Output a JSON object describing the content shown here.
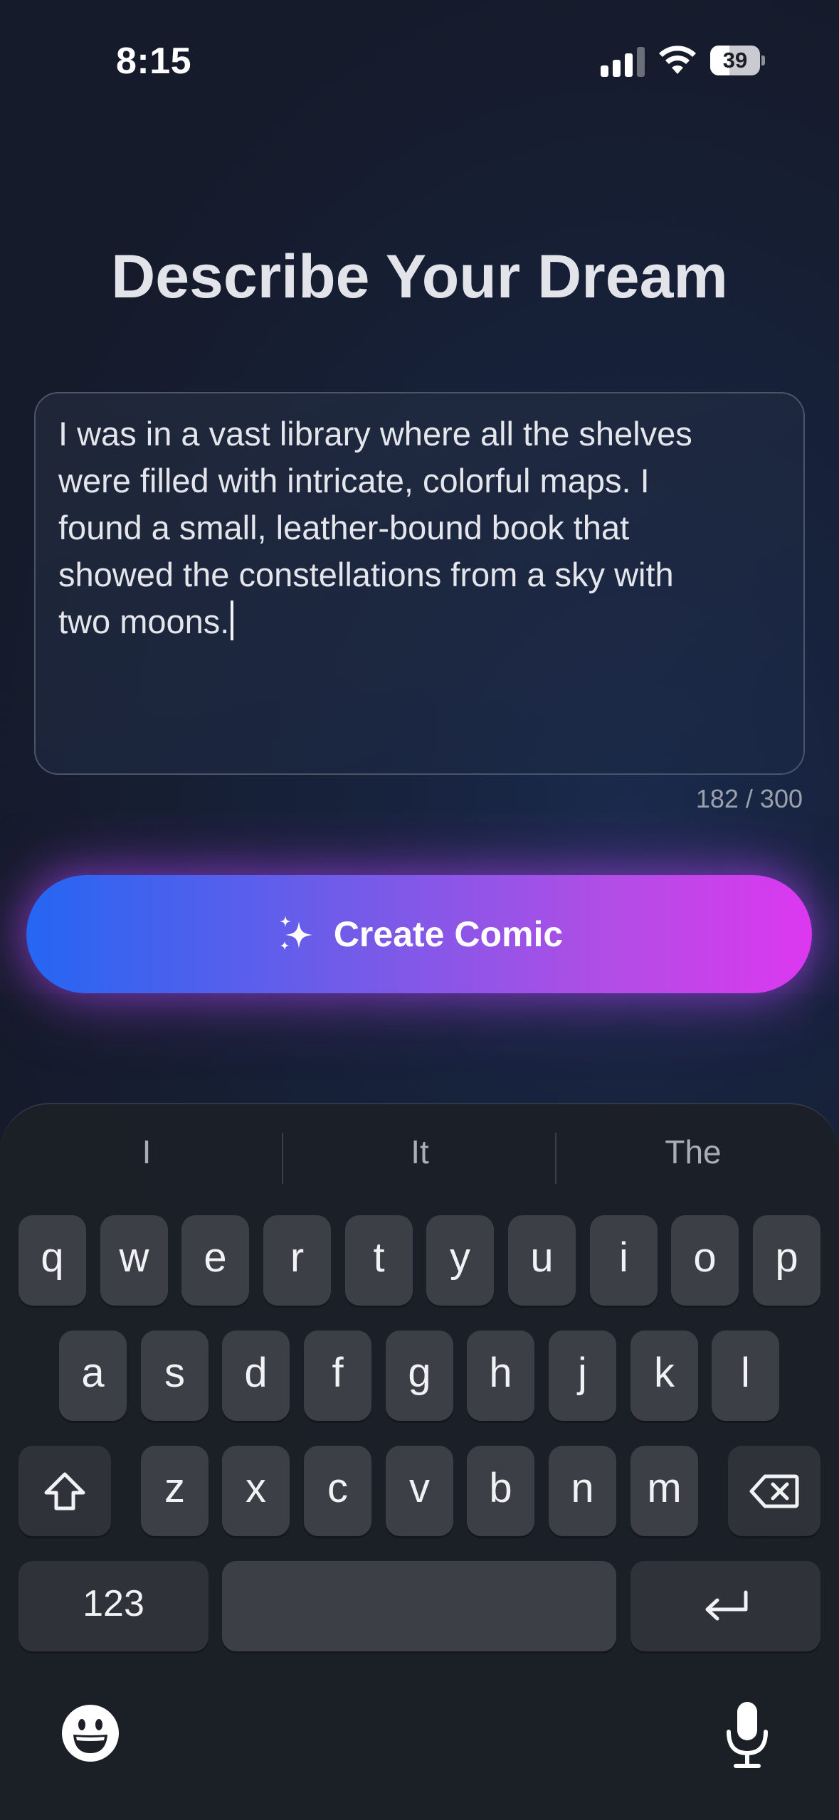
{
  "status_bar": {
    "time": "8:15",
    "battery": "39",
    "battery_level": 0.39,
    "signal_bars": 3
  },
  "page": {
    "title": "Describe Your Dream"
  },
  "dream_input": {
    "value": "I was in a vast library where all the shelves\nwere filled with intricate, colorful maps. I\nfound a small, leather-bound book that\nshowed the constellations from a sky with\ntwo moons.",
    "char_count": "182 / 300"
  },
  "create_button": {
    "label": "Create Comic",
    "icon": "sparkle-icon"
  },
  "colors": {
    "gradient_start": "#2466f2",
    "gradient_end": "#dc38f0",
    "background": "#151b2b"
  },
  "keyboard": {
    "suggestions": [
      "I",
      "It",
      "The"
    ],
    "row1": [
      "q",
      "w",
      "e",
      "r",
      "t",
      "y",
      "u",
      "i",
      "o",
      "p"
    ],
    "row2": [
      "a",
      "s",
      "d",
      "f",
      "g",
      "h",
      "j",
      "k",
      "l"
    ],
    "row3": [
      "z",
      "x",
      "c",
      "v",
      "b",
      "n",
      "m"
    ],
    "numbers_label": "123",
    "shift_icon": "shift-icon",
    "delete_icon": "backspace-icon",
    "return_icon": "return-icon",
    "emoji_icon": "emoji-icon",
    "mic_icon": "microphone-icon"
  }
}
